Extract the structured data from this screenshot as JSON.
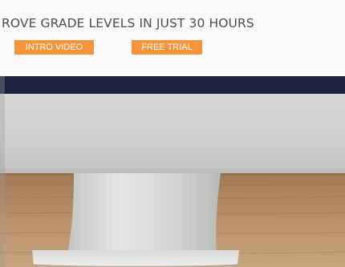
{
  "hero": {
    "headline": "ROVE GRADE LEVELS IN JUST 30 HOURS",
    "intro_video_label": "INTRO VIDEO",
    "free_trial_label": "FREE TRIAL"
  },
  "colors": {
    "accent": "#f5943a",
    "headline_text": "#4d4d4d",
    "header_background": "#fafafa"
  },
  "photo": {
    "subject": "computer-monitor-on-wooden-desk"
  }
}
